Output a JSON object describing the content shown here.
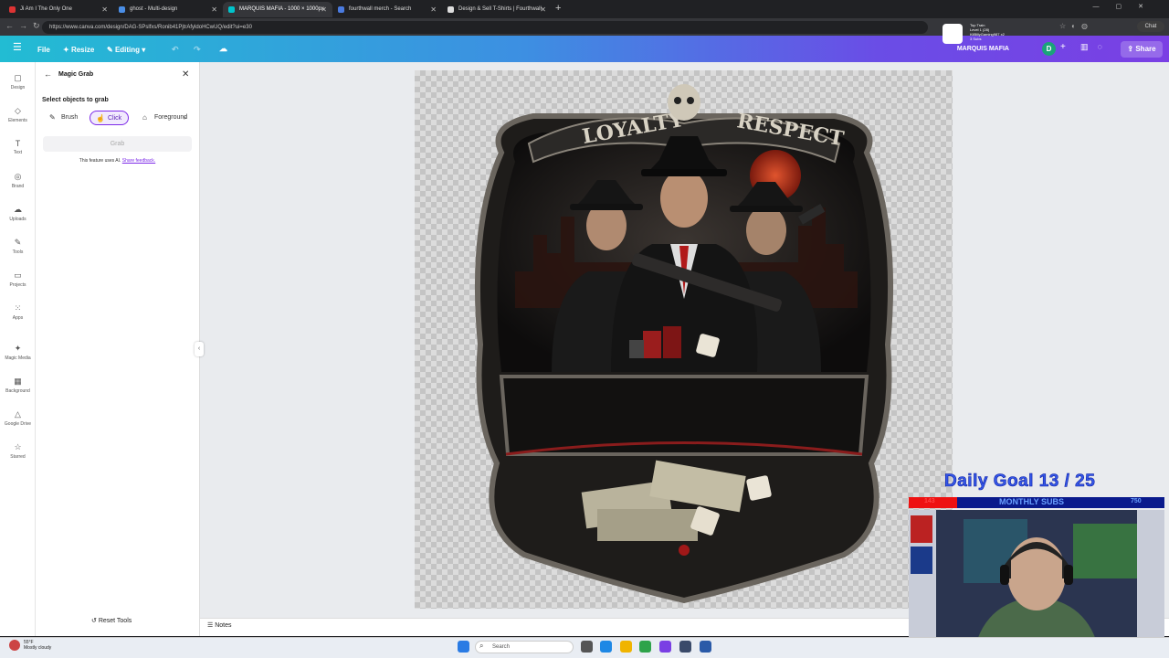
{
  "browser": {
    "tabs": [
      {
        "label": "Ji Am I The Only One",
        "favicon_color": "#d33"
      },
      {
        "label": "ghost - Multi-design",
        "favicon_color": "#4a8ee6"
      },
      {
        "label": "MARQUIS MAFIA - 1000 × 1000px",
        "favicon_color": "#00c4cc"
      },
      {
        "label": "fourthwall merch - Search",
        "favicon_color": "#4a7be0"
      },
      {
        "label": "Design & Sell T-Shirts | Fourthwall",
        "favicon_color": "#ddd"
      }
    ],
    "new_tab": "+",
    "url": "https://www.canva.com/design/DAG-SPslfxs/Ronib41PjtrAfyldoHCwUQ/edit?ui=e30",
    "chat_label": "Chat"
  },
  "stream_overlay": {
    "train_lines": [
      "Top Train",
      "Level 1 (28)",
      "KilBillyGaming987 x2",
      "3 Subs"
    ]
  },
  "toolbar": {
    "file": "File",
    "resize": "Resize",
    "editing": "Editing",
    "title": "MARQUIS MAFIA",
    "avatar_letter": "D",
    "share": "Share"
  },
  "rail": [
    {
      "label": "Design",
      "icon": "design-icon",
      "glyph": "▢"
    },
    {
      "label": "Elements",
      "icon": "elements-icon",
      "glyph": "◇"
    },
    {
      "label": "Text",
      "icon": "text-icon",
      "glyph": "T"
    },
    {
      "label": "Brand",
      "icon": "brand-icon",
      "glyph": "◎"
    },
    {
      "label": "Uploads",
      "icon": "uploads-icon",
      "glyph": "☁"
    },
    {
      "label": "Tools",
      "icon": "tools-icon",
      "glyph": "✎"
    },
    {
      "label": "Projects",
      "icon": "projects-icon",
      "glyph": "▭"
    },
    {
      "label": "Apps",
      "icon": "apps-icon",
      "glyph": "⁙"
    },
    {
      "label": "Magic Media",
      "icon": "magic-media-icon",
      "glyph": "✦"
    },
    {
      "label": "Background",
      "icon": "background-icon",
      "glyph": "▦"
    },
    {
      "label": "Google Drive",
      "icon": "google-drive-icon",
      "glyph": "△"
    },
    {
      "label": "Starred",
      "icon": "star-icon",
      "glyph": "☆"
    }
  ],
  "panel": {
    "title": "Magic Grab",
    "select_label": "Select objects to grab",
    "modes": {
      "brush": "Brush",
      "click": "Click",
      "foreground": "Foreground"
    },
    "grab_button": "Grab",
    "ai_note": "This feature uses AI.",
    "feedback_link": "Share feedback.",
    "reset": "Reset Tools"
  },
  "canvas": {
    "banner_left": "LOYALTY",
    "banner_right": "RESPECT"
  },
  "notes": "Notes",
  "goal": {
    "text": "Daily Goal  13 / 25",
    "current": "143",
    "label": "MONTHLY SUBS",
    "max": "750",
    "progress": 0.19
  },
  "taskbar": {
    "weather_temp": "55°F",
    "weather_desc": "Mostly cloudy",
    "search": "Search"
  }
}
